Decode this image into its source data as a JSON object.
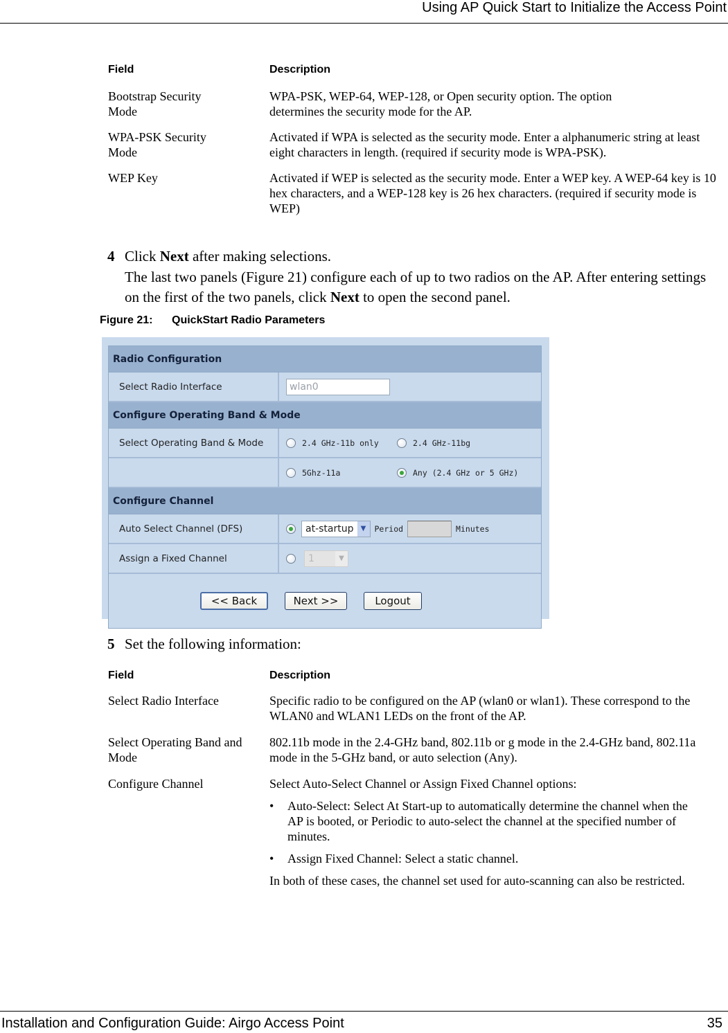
{
  "header": {
    "title": "Using AP Quick Start to Initialize the Access Point"
  },
  "footer": {
    "guide_title": "Installation and Configuration Guide: Airgo Access Point",
    "page_number": "35"
  },
  "table1": {
    "headers": {
      "field": "Field",
      "description": "Description"
    },
    "rows": [
      {
        "field": "Bootstrap Security Mode",
        "description": "WPA-PSK, WEP-64, WEP-128, or Open security option. The option determines the security mode for the AP."
      },
      {
        "field": "WPA-PSK Security Mode",
        "description": "Activated if WPA is selected as the security mode. Enter a alphanumeric string at least eight characters in length. (required if security mode is WPA-PSK)."
      },
      {
        "field": "WEP Key",
        "description": "Activated if WEP is selected as the security mode. Enter a WEP key. A WEP-64 key is 10 hex characters, and a WEP-128 key is 26 hex characters. (required if security mode is WEP)"
      }
    ]
  },
  "step4": {
    "number": "4",
    "pre": "Click ",
    "bold": "Next",
    "post": " after making selections.",
    "para_pre": "The last two panels (Figure 21) configure each of up to two radios on the AP. After entering settings on the first of the two panels, click ",
    "para_bold": "Next",
    "para_post": " to open the second panel."
  },
  "figure": {
    "label": "Figure 21:",
    "title": "QuickStart Radio Parameters"
  },
  "panel": {
    "sections": {
      "radio_config": "Radio Configuration",
      "band_mode": "Configure Operating Band & Mode",
      "channel": "Configure Channel"
    },
    "radio_interface": {
      "label": "Select Radio Interface",
      "value": "wlan0"
    },
    "band": {
      "label": "Select Operating Band & Mode",
      "options": [
        {
          "label": "2.4 GHz-11b only",
          "selected": false
        },
        {
          "label": "2.4 GHz-11bg",
          "selected": false
        },
        {
          "label": "5Ghz-11a",
          "selected": false
        },
        {
          "label": "Any (2.4 GHz or 5 GHz)",
          "selected": true
        }
      ]
    },
    "auto_channel": {
      "label": "Auto Select Channel (DFS)",
      "selected": true,
      "mode_value": "at-startup",
      "period_label": "Period",
      "period_value": "",
      "minutes_label": "Minutes"
    },
    "fixed_channel": {
      "label": "Assign a Fixed Channel",
      "selected": false,
      "channel_value": "1"
    },
    "buttons": {
      "back": "<< Back",
      "next": "Next >>",
      "logout": "Logout"
    }
  },
  "step5": {
    "number": "5",
    "text": "Set the following information:"
  },
  "table2": {
    "headers": {
      "field": "Field",
      "description": "Description"
    },
    "rows": [
      {
        "field": "Select Radio Interface",
        "description": "Specific radio to be configured on the AP (wlan0 or wlan1). These correspond to the WLAN0 and WLAN1 LEDs on the front of the AP."
      },
      {
        "field": "Select Operating Band and Mode",
        "description": "802.11b mode in the 2.4-GHz band, 802.11b or g mode in the 2.4-GHz band, 802.11a mode in the 5-GHz band, or auto selection (Any)."
      },
      {
        "field": "Configure Channel",
        "description": "Select Auto-Select Channel or Assign Fixed Channel options:",
        "bullets": [
          "Auto-Select: Select At Start-up to automatically determine the channel when the AP is booted, or Periodic to auto-select the channel at the specified number of minutes.",
          "Assign Fixed Channel: Select a static channel."
        ],
        "bullet_glyph": "•",
        "note": "In both of these cases, the channel set used for auto-scanning can also be restricted."
      }
    ]
  }
}
